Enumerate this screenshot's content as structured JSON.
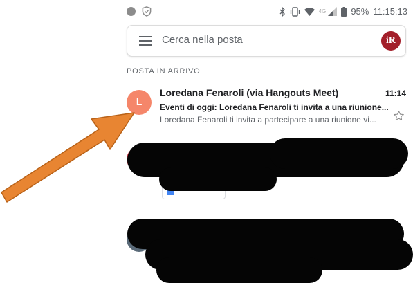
{
  "status_bar": {
    "battery": "95%",
    "time": "11:15:13",
    "network_label": "4G"
  },
  "search": {
    "placeholder": "Cerca nella posta",
    "avatar_initials": "iR"
  },
  "section_label": "POSTA IN ARRIVO",
  "email": {
    "avatar_letter": "L",
    "sender": "Loredana Fenaroli (via Hangouts Meet)",
    "time": "11:14",
    "subject": "Eventi di oggi: Loredana Fenaroli ti invita a una riunione...",
    "snippet": "Loredana Fenaroli ti invita a partecipare a una riunione vi..."
  },
  "colors": {
    "accent_avatar": "#f5866a",
    "profile_avatar": "#a31f2a",
    "arrow": "#e88532",
    "redaction": "#050505"
  },
  "icons": [
    "shield-icon",
    "bluetooth-icon",
    "vibrate-icon",
    "wifi-icon",
    "signal-icon",
    "battery-icon",
    "menu-icon",
    "star-icon"
  ]
}
